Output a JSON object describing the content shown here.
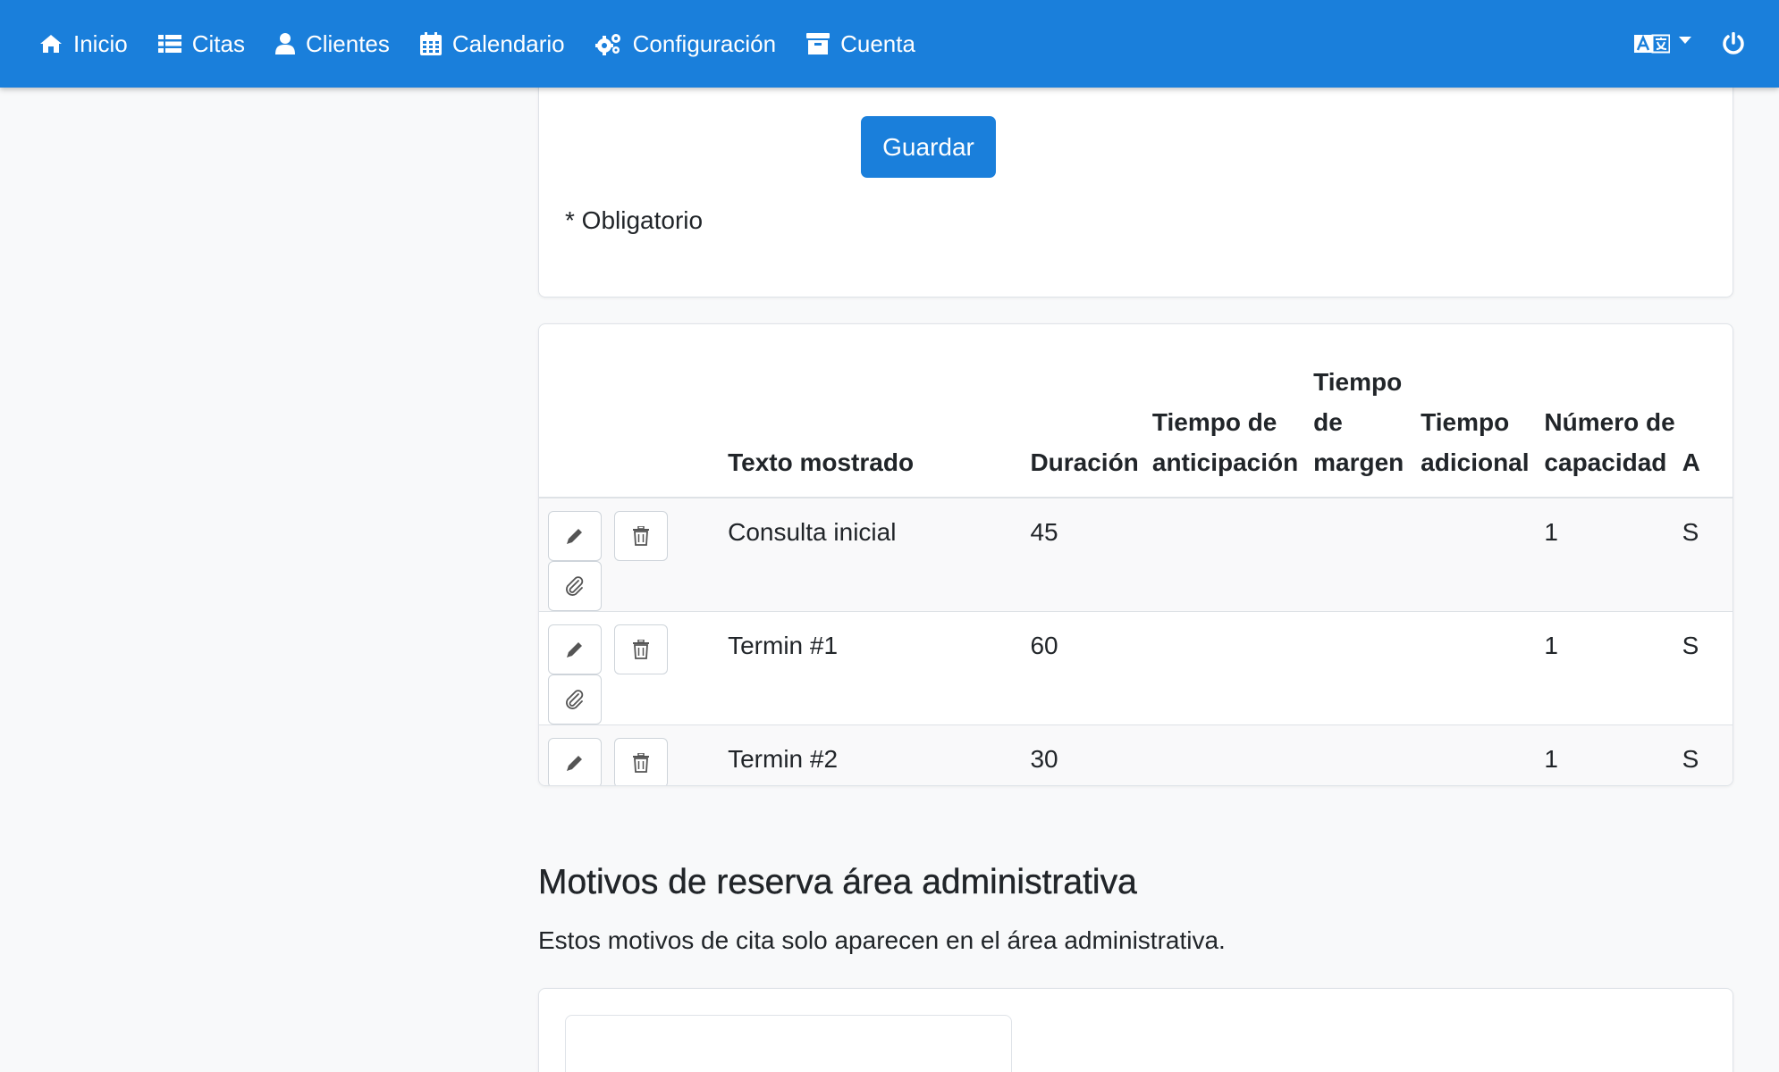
{
  "nav": {
    "items": [
      {
        "label": "Inicio",
        "icon": "home-icon"
      },
      {
        "label": "Citas",
        "icon": "list-icon"
      },
      {
        "label": "Clientes",
        "icon": "user-icon"
      },
      {
        "label": "Calendario",
        "icon": "calendar-icon"
      },
      {
        "label": "Configuración",
        "icon": "cogs-icon"
      },
      {
        "label": "Cuenta",
        "icon": "archive-icon"
      }
    ],
    "language_icon": "language-icon",
    "power_icon": "power-icon"
  },
  "form": {
    "save_label": "Guardar",
    "required_note": "* Obligatorio"
  },
  "table": {
    "headers": {
      "text": "Texto mostrado",
      "duration": "Duración",
      "lead_time": "Tiempo de anticipación",
      "buffer": "Tiempo de margen",
      "extra": "Tiempo adicional",
      "capacity": "Número de capacidad",
      "next_cut": "A"
    },
    "rows": [
      {
        "text": "Consulta inicial",
        "duration": "45",
        "lead_time": "",
        "buffer": "",
        "extra": "",
        "capacity": "1",
        "next_cut": "S"
      },
      {
        "text": "Termin #1",
        "duration": "60",
        "lead_time": "",
        "buffer": "",
        "extra": "",
        "capacity": "1",
        "next_cut": "S"
      },
      {
        "text": "Termin #2",
        "duration": "30",
        "lead_time": "",
        "buffer": "",
        "extra": "",
        "capacity": "1",
        "next_cut": "S"
      }
    ],
    "row_action_icons": [
      "pencil-icon",
      "trash-icon",
      "paperclip-icon"
    ]
  },
  "admin_section": {
    "title": "Motivos de reserva área administrativa",
    "description": "Estos motivos de cita solo aparecen en el área administrativa."
  },
  "colors": {
    "navbar": "#1a7fdb",
    "primary_button": "#1a7fdb",
    "page_background": "#f8f9fa"
  }
}
